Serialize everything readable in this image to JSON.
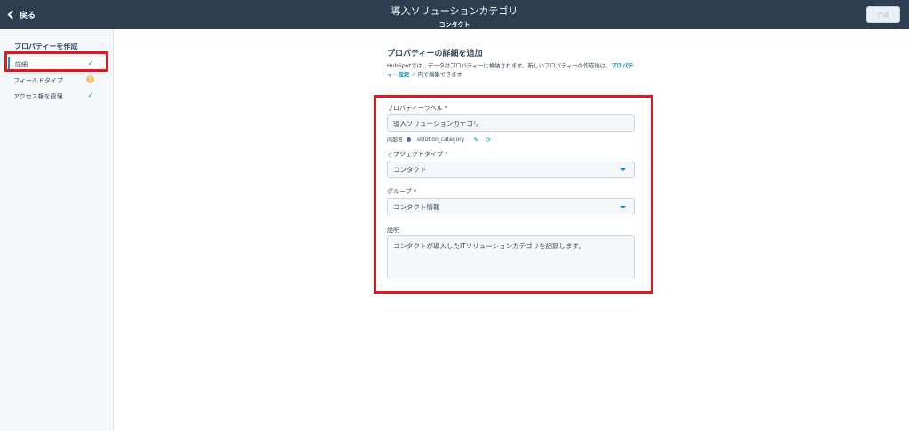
{
  "topbar": {
    "back_label": "戻る",
    "title": "導入ソリューションカテゴリ",
    "subtitle": "コンタクト",
    "create_label": "作成"
  },
  "sidebar": {
    "heading": "プロパティーを作成",
    "items": [
      {
        "label": "詳細",
        "status": "check"
      },
      {
        "label": "フィールドタイプ",
        "status": "warning"
      },
      {
        "label": "アクセス権を管理",
        "status": "check"
      }
    ]
  },
  "form": {
    "title": "プロパティーの詳細を追加",
    "desc_before": "HubSpotでは、データはプロパティーに格納されます。新しいプロパティーの作成後は、",
    "desc_link": "プロパティー設定",
    "desc_after": "内で編集できます",
    "property_label": {
      "label": "プロパティーラベル *",
      "value": "導入ソリューションカテゴリ"
    },
    "internal_name": {
      "label": "内部名",
      "value": "solution_category"
    },
    "object_type": {
      "label": "オブジェクトタイプ *",
      "value": "コンタクト"
    },
    "group": {
      "label": "グループ *",
      "value": "コンタクト情報"
    },
    "description": {
      "label": "説明",
      "value": "コンタクトが導入したITソリューションカテゴリを記録します。"
    }
  },
  "colors": {
    "topbar": "#2d3e50",
    "accent": "#00a4bd",
    "link": "#0091ae",
    "highlight": "#e5171c",
    "warning": "#f5c26b"
  }
}
